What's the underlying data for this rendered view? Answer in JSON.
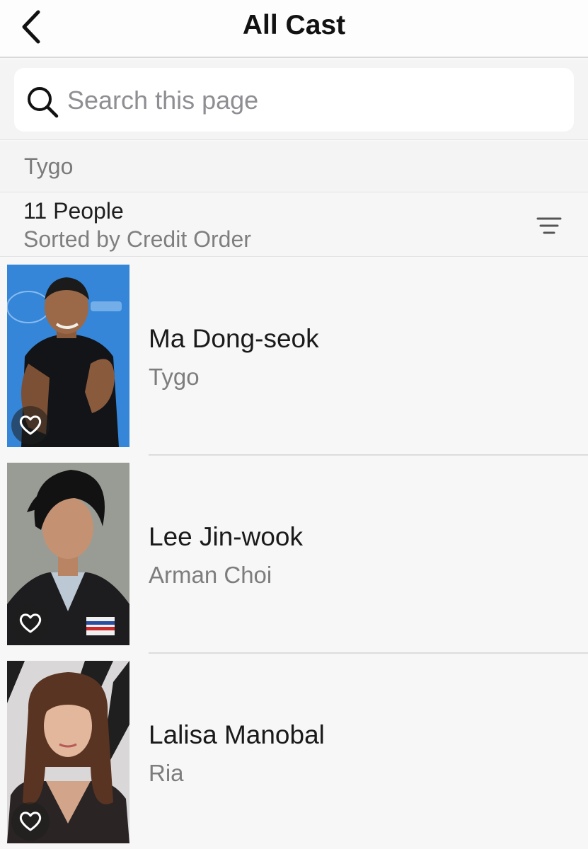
{
  "header": {
    "title": "All Cast",
    "back_icon": "chevron-left-icon"
  },
  "search": {
    "placeholder": "Search this page",
    "value": "",
    "icon": "search-icon"
  },
  "section": {
    "title": "Tygo"
  },
  "summary": {
    "count_label": "11 People",
    "sort_label": "Sorted by Credit Order",
    "sort_icon": "sort-lines-icon"
  },
  "cast": [
    {
      "name": "Ma Dong-seok",
      "character": "Tygo",
      "favorite_icon": "heart-outline-icon"
    },
    {
      "name": "Lee Jin-wook",
      "character": "Arman Choi",
      "favorite_icon": "heart-outline-icon"
    },
    {
      "name": "Lalisa Manobal",
      "character": "Ria",
      "favorite_icon": "heart-outline-icon"
    }
  ],
  "colors": {
    "background": "#f8f8f8",
    "secondary_text": "#7d7d7d",
    "divider": "#dcdcdc",
    "photo1_backdrop": "#2f7fd1"
  }
}
